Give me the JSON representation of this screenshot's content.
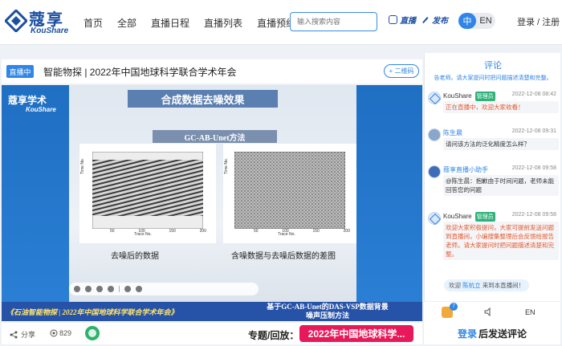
{
  "header": {
    "logo_cn": "蔻享",
    "logo_en": "KouShare",
    "nav": [
      "首页",
      "全部",
      "直播日程",
      "直播列表",
      "直播预约"
    ],
    "search_placeholder": "输入搜索内容",
    "live_label": "直播",
    "publish_label": "发布",
    "lang_cn": "中",
    "lang_en": "EN",
    "auth": "登录 / 注册"
  },
  "player": {
    "status_badge": "直播中",
    "title": "智能物探 | 2022年中国地球科学联合学术年会",
    "qr_button": "+ 二维码",
    "slide": {
      "logo_cn": "蔻享学术",
      "logo_en": "KouShare",
      "heading": "合成数据去噪效果",
      "method": "GC-AB-Unet方法",
      "axis_y": "Time No.",
      "axis_x": "Trace No.",
      "x_ticks": [
        "50",
        "100",
        "150",
        "200"
      ],
      "caption_left": "去噪后的数据",
      "caption_right": "含噪数据与去噪后数据的差图",
      "banner_left": "《石油智能物探 | 2022年中国地球科学联合学术年会》",
      "banner_right_1": "基于GC-AB-Unet的DAS-VSP数据背景",
      "banner_right_2": "噪声压制方法"
    }
  },
  "footer": {
    "share": "分享",
    "views": "829",
    "topic_label": "专题/回放：",
    "topic_value": "2022年中国地球科学..."
  },
  "comments": {
    "header": "评论",
    "notice": "告老师。请大家提问时把问题描述清楚和完整。",
    "items": [
      {
        "name": "KouShare",
        "badge": "管理员",
        "time": "2022-12-08 08:42",
        "text": "正在直播中，欢迎大家收看！",
        "type": "admin"
      },
      {
        "name": "陈生晨",
        "badge": "",
        "time": "2022-12-08 09:31",
        "text": "请问该方法的泛化精度怎么样？",
        "type": "plain"
      },
      {
        "name": "蔻享直播小助手",
        "badge": "",
        "time": "2022-12-08 09:58",
        "text": "@陈生晨：抱歉由于时间问题，老师未能回答您的问题",
        "type": "plain"
      },
      {
        "name": "KouShare",
        "badge": "管理员",
        "time": "2022-12-08 09:58",
        "text": "欢迎大家积极提问，大家可提前发送问题到直播间，小编搜集整理后会反馈给报告老师。请大家提问时把问题描述清楚和完整。",
        "type": "admin"
      }
    ],
    "welcome_prefix": "欢迎",
    "welcome_name": "陈杭立",
    "welcome_suffix": "来到本直播间！",
    "like_count": "7",
    "en_toggle": "EN",
    "login_link": "登录",
    "post_label": "后发送评论"
  },
  "colors": {
    "accent": "#2f86e6",
    "brand": "#1b4fa0",
    "admin_text": "#e8572a",
    "topic_pill": "#e8195a"
  }
}
